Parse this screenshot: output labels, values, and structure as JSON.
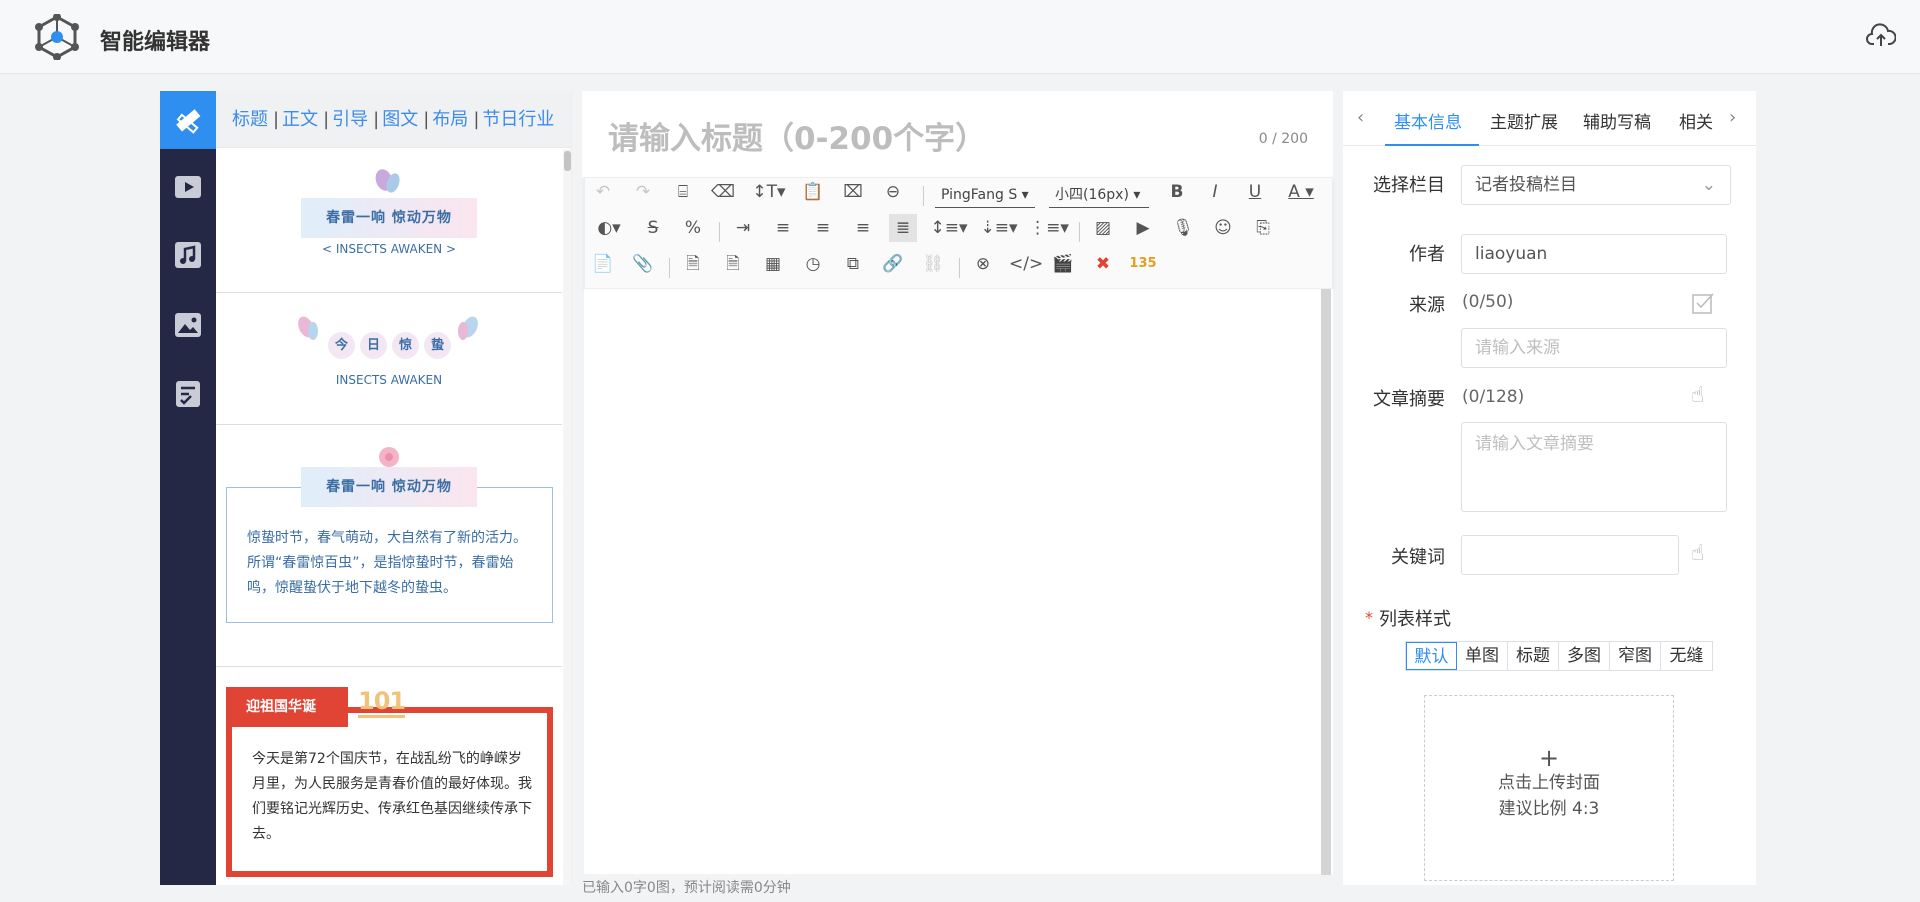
{
  "app": {
    "title": "智能编辑器"
  },
  "template_panel": {
    "tabs": [
      "标题",
      "正文",
      "引导",
      "图文",
      "布局",
      "节日行业"
    ],
    "separator": "|",
    "items": [
      {
        "banner": "春雷一响 惊动万物",
        "subtitle": "< INSECTS AWAKEN >"
      },
      {
        "chars": [
          "今",
          "日",
          "惊",
          "蛰"
        ],
        "subtitle": "INSECTS AWAKEN"
      },
      {
        "banner": "春雷一响 惊动万物",
        "body": "惊蛰时节，春气萌动，大自然有了新的活力。所谓“春雷惊百虫”，是指惊蛰时节，春雷始鸣，惊醒蛰伏于地下越冬的蛰虫。"
      },
      {
        "tag": "迎祖国华诞",
        "badge": "101",
        "body": "今天是第72个国庆节，在战乱纷飞的峥嵘岁月里，为人民服务是青春价值的最好体现。我们要铭记光辉历史、传承红色基因继续传承下去。"
      }
    ]
  },
  "editor": {
    "title_placeholder": "请输入标题（0-200个字）",
    "title_count": "0 / 200",
    "font_family": "PingFang S",
    "font_size": "小四(16px)",
    "status": "已输入0字0图，预计阅读需0分钟"
  },
  "right_panel": {
    "tabs": [
      "基本信息",
      "主题扩展",
      "辅助写稿",
      "相关"
    ],
    "column_label": "选择栏目",
    "column_value": "记者投稿栏目",
    "author_label": "作者",
    "author_value": "liaoyuan",
    "source_label": "来源",
    "source_count": "(0/50)",
    "source_placeholder": "请输入来源",
    "summary_label": "文章摘要",
    "summary_count": "(0/128)",
    "summary_placeholder": "请输入文章摘要",
    "keywords_label": "关键词",
    "list_style_label": "列表样式",
    "required_mark": "*",
    "list_styles": [
      "默认",
      "单图",
      "标题",
      "多图",
      "窄图",
      "无缝"
    ],
    "cover_plus": "+",
    "cover_line1": "点击上传封面",
    "cover_line2": "建议比例 4:3"
  }
}
